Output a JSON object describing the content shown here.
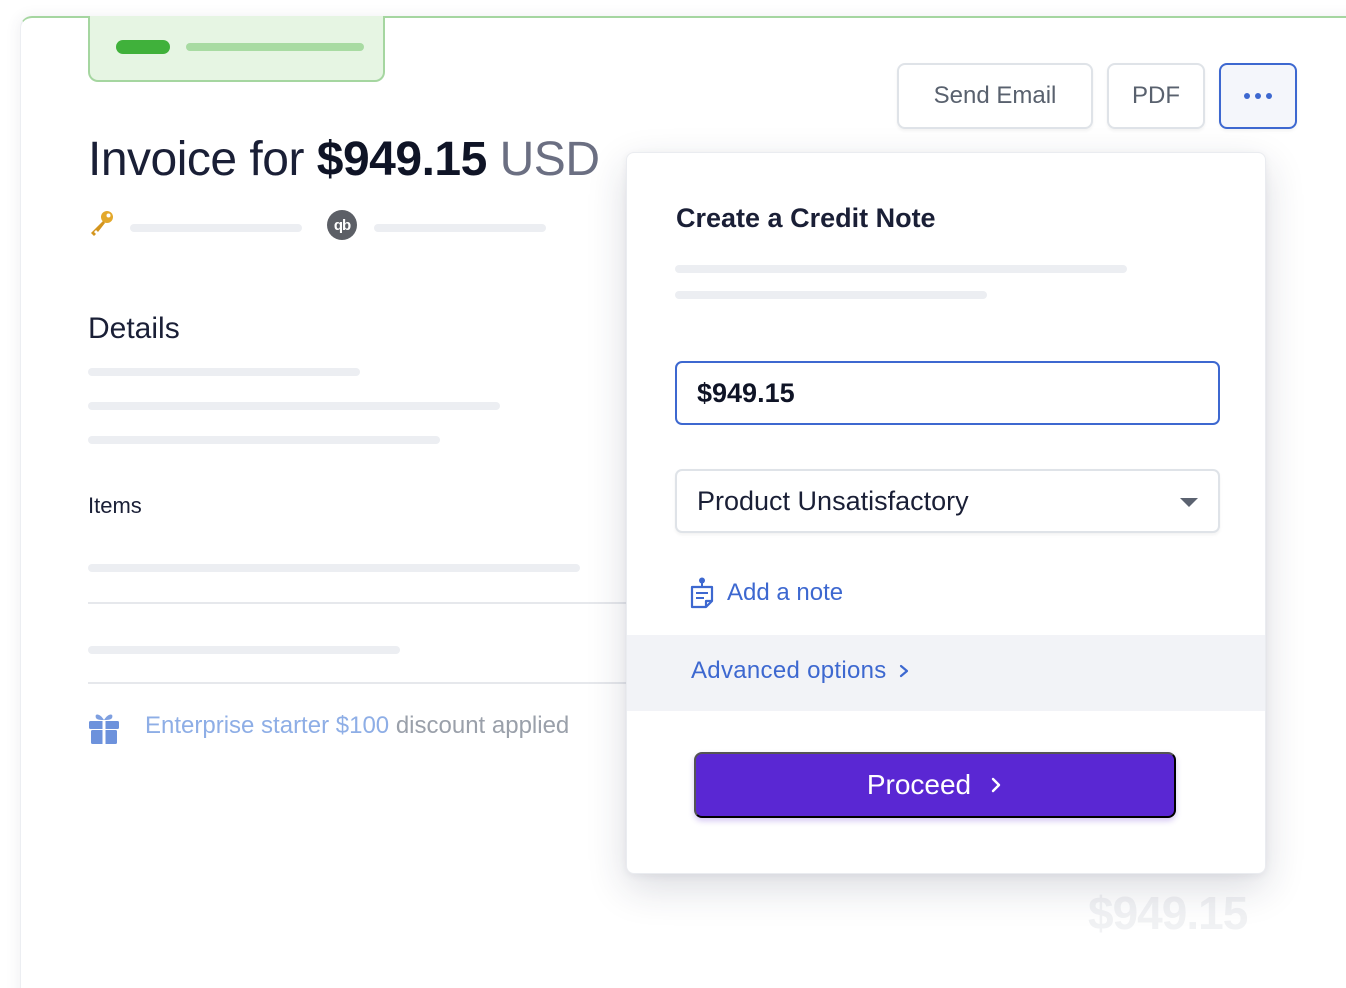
{
  "header": {
    "send_email_label": "Send Email",
    "pdf_label": "PDF",
    "more_icon": "more-dots-icon"
  },
  "invoice": {
    "title_prefix": "Invoice for",
    "amount": "$949.15",
    "currency": "USD",
    "details_heading": "Details",
    "items_heading": "Items",
    "discount": {
      "name": "Enterprise starter",
      "amount": "$100",
      "suffix": "discount applied"
    },
    "ghost_amount": "$949.15"
  },
  "credit_note": {
    "title": "Create a Credit Note",
    "amount_value": "$949.15",
    "reason_selected": "Product Unsatisfactory",
    "add_note_label": "Add a note",
    "advanced_label": "Advanced options",
    "proceed_label": "Proceed"
  },
  "colors": {
    "accent_blue": "#3d68d0",
    "proceed_purple": "#5a27d3",
    "status_green": "#40b13b"
  }
}
